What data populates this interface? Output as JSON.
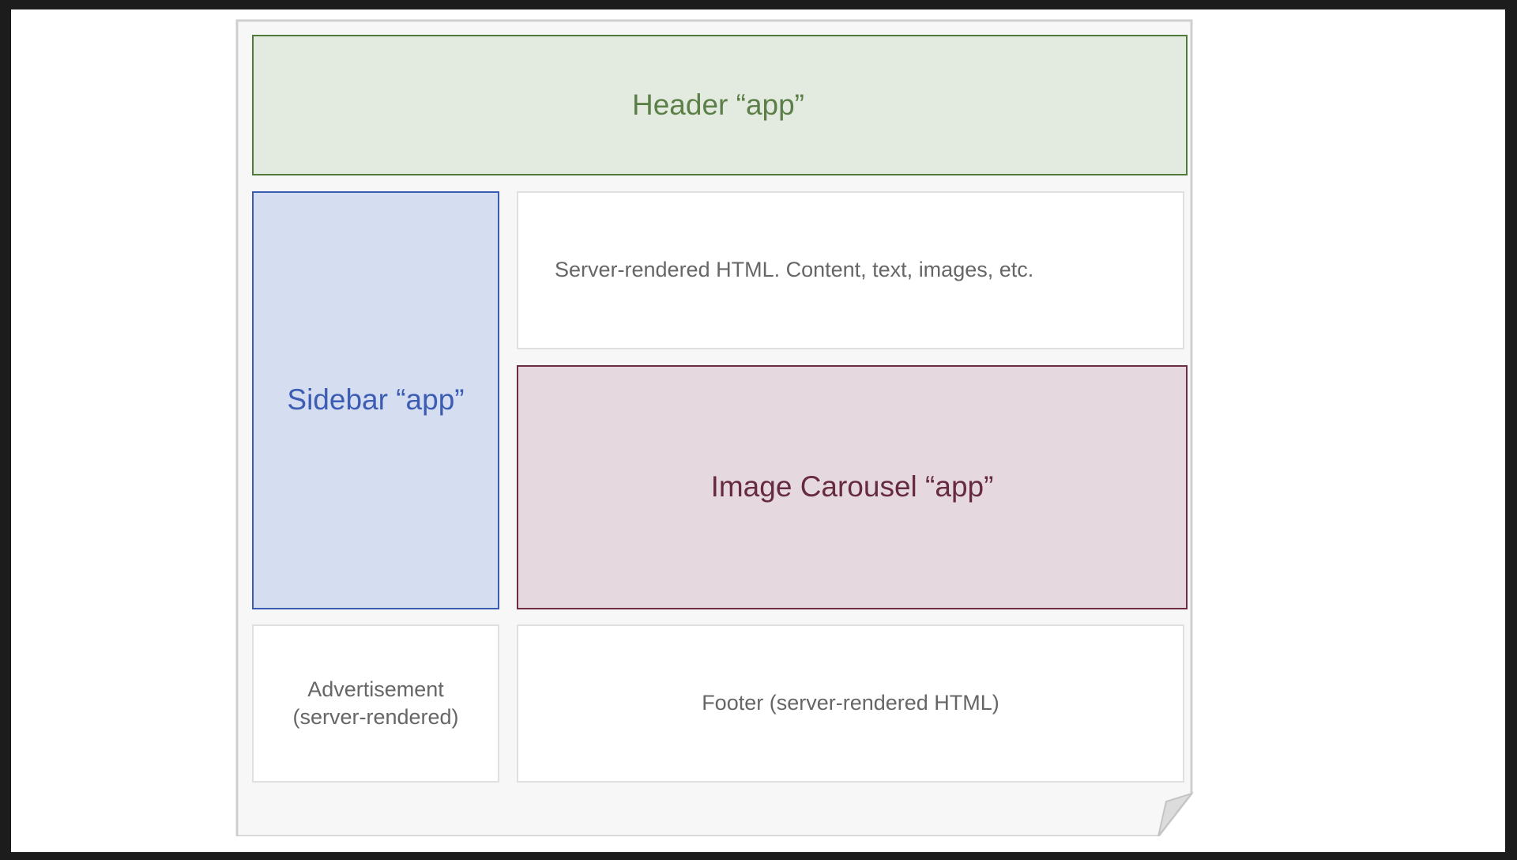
{
  "diagram": {
    "header": {
      "label": "Header “app”"
    },
    "sidebar": {
      "label": "Sidebar “app”"
    },
    "content": {
      "label": "Server-rendered HTML. Content, text, images, etc."
    },
    "carousel": {
      "label": "Image Carousel “app”"
    },
    "advertisement": {
      "line1": "Advertisement",
      "line2": "(server-rendered)"
    },
    "footer": {
      "label": "Footer (server-rendered HTML)"
    }
  },
  "colors": {
    "header_fill": "#e3ebe0",
    "header_border": "#4f7a3a",
    "sidebar_fill": "#d5ddf1",
    "sidebar_border": "#3b5bb0",
    "carousel_fill": "#e5d9df",
    "carousel_border": "#6e2d42"
  }
}
